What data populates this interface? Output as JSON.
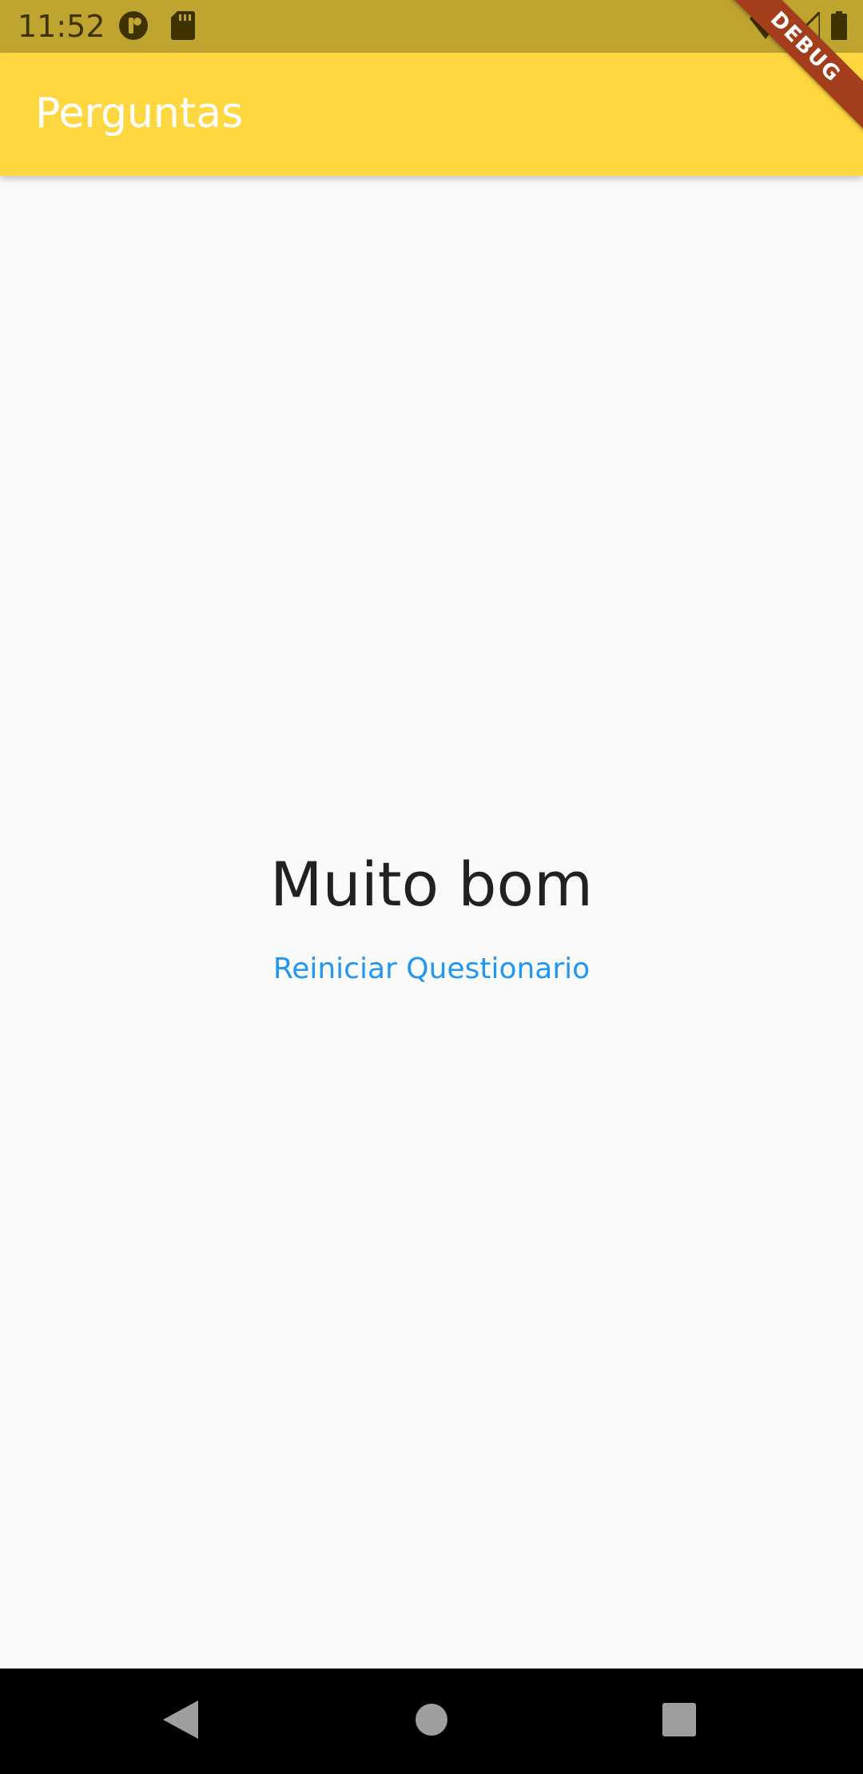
{
  "status_bar": {
    "time": "11:52",
    "left_icons": [
      "app-notification-icon",
      "sd-card-icon"
    ],
    "right_icons": [
      "wifi-icon",
      "cell-signal-icon",
      "battery-icon"
    ],
    "background": "#BFA42F"
  },
  "app_bar": {
    "title": "Perguntas",
    "background": "#FFD740",
    "title_color": "#FFFFFF"
  },
  "debug_banner": {
    "label": "DEBUG",
    "color": "#A33D1C"
  },
  "main": {
    "result_text": "Muito bom",
    "restart_button_label": "Reiniciar Questionario",
    "accent_color": "#2196F3"
  },
  "nav_bar": {
    "buttons": [
      "back-icon",
      "home-icon",
      "recents-icon"
    ]
  }
}
